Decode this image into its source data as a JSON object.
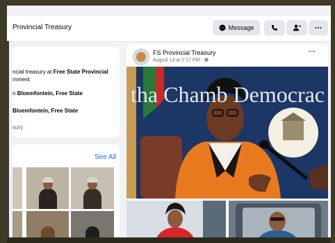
{
  "header": {
    "page_name": "Provincial Treasury",
    "message_label": "Message",
    "more_icon": "more-horizontal-icon",
    "call_icon": "phone-icon",
    "add_friend_icon": "add-person-icon"
  },
  "intro": {
    "line1_prefix": "ncial treasury at ",
    "line1_bold": "Free State Provincial",
    "line2": "rnment",
    "line3_prefix": "n ",
    "line3_bold": "Bloemfontein, Free State",
    "line4_bold": "Bloemfontein, Free State",
    "link": "sury"
  },
  "photos": {
    "see_all": "See All"
  },
  "post": {
    "author": "FS Provincial Treasury",
    "timestamp": "August 13 at 2:17 PM · ",
    "banner_text": "tha Chamb   Democrac",
    "more_icon": "more-horizontal-icon"
  },
  "colors": {
    "fb_blue": "#216fdb",
    "page_bg": "#f0f2f5",
    "button_bg": "#e4e6eb"
  }
}
